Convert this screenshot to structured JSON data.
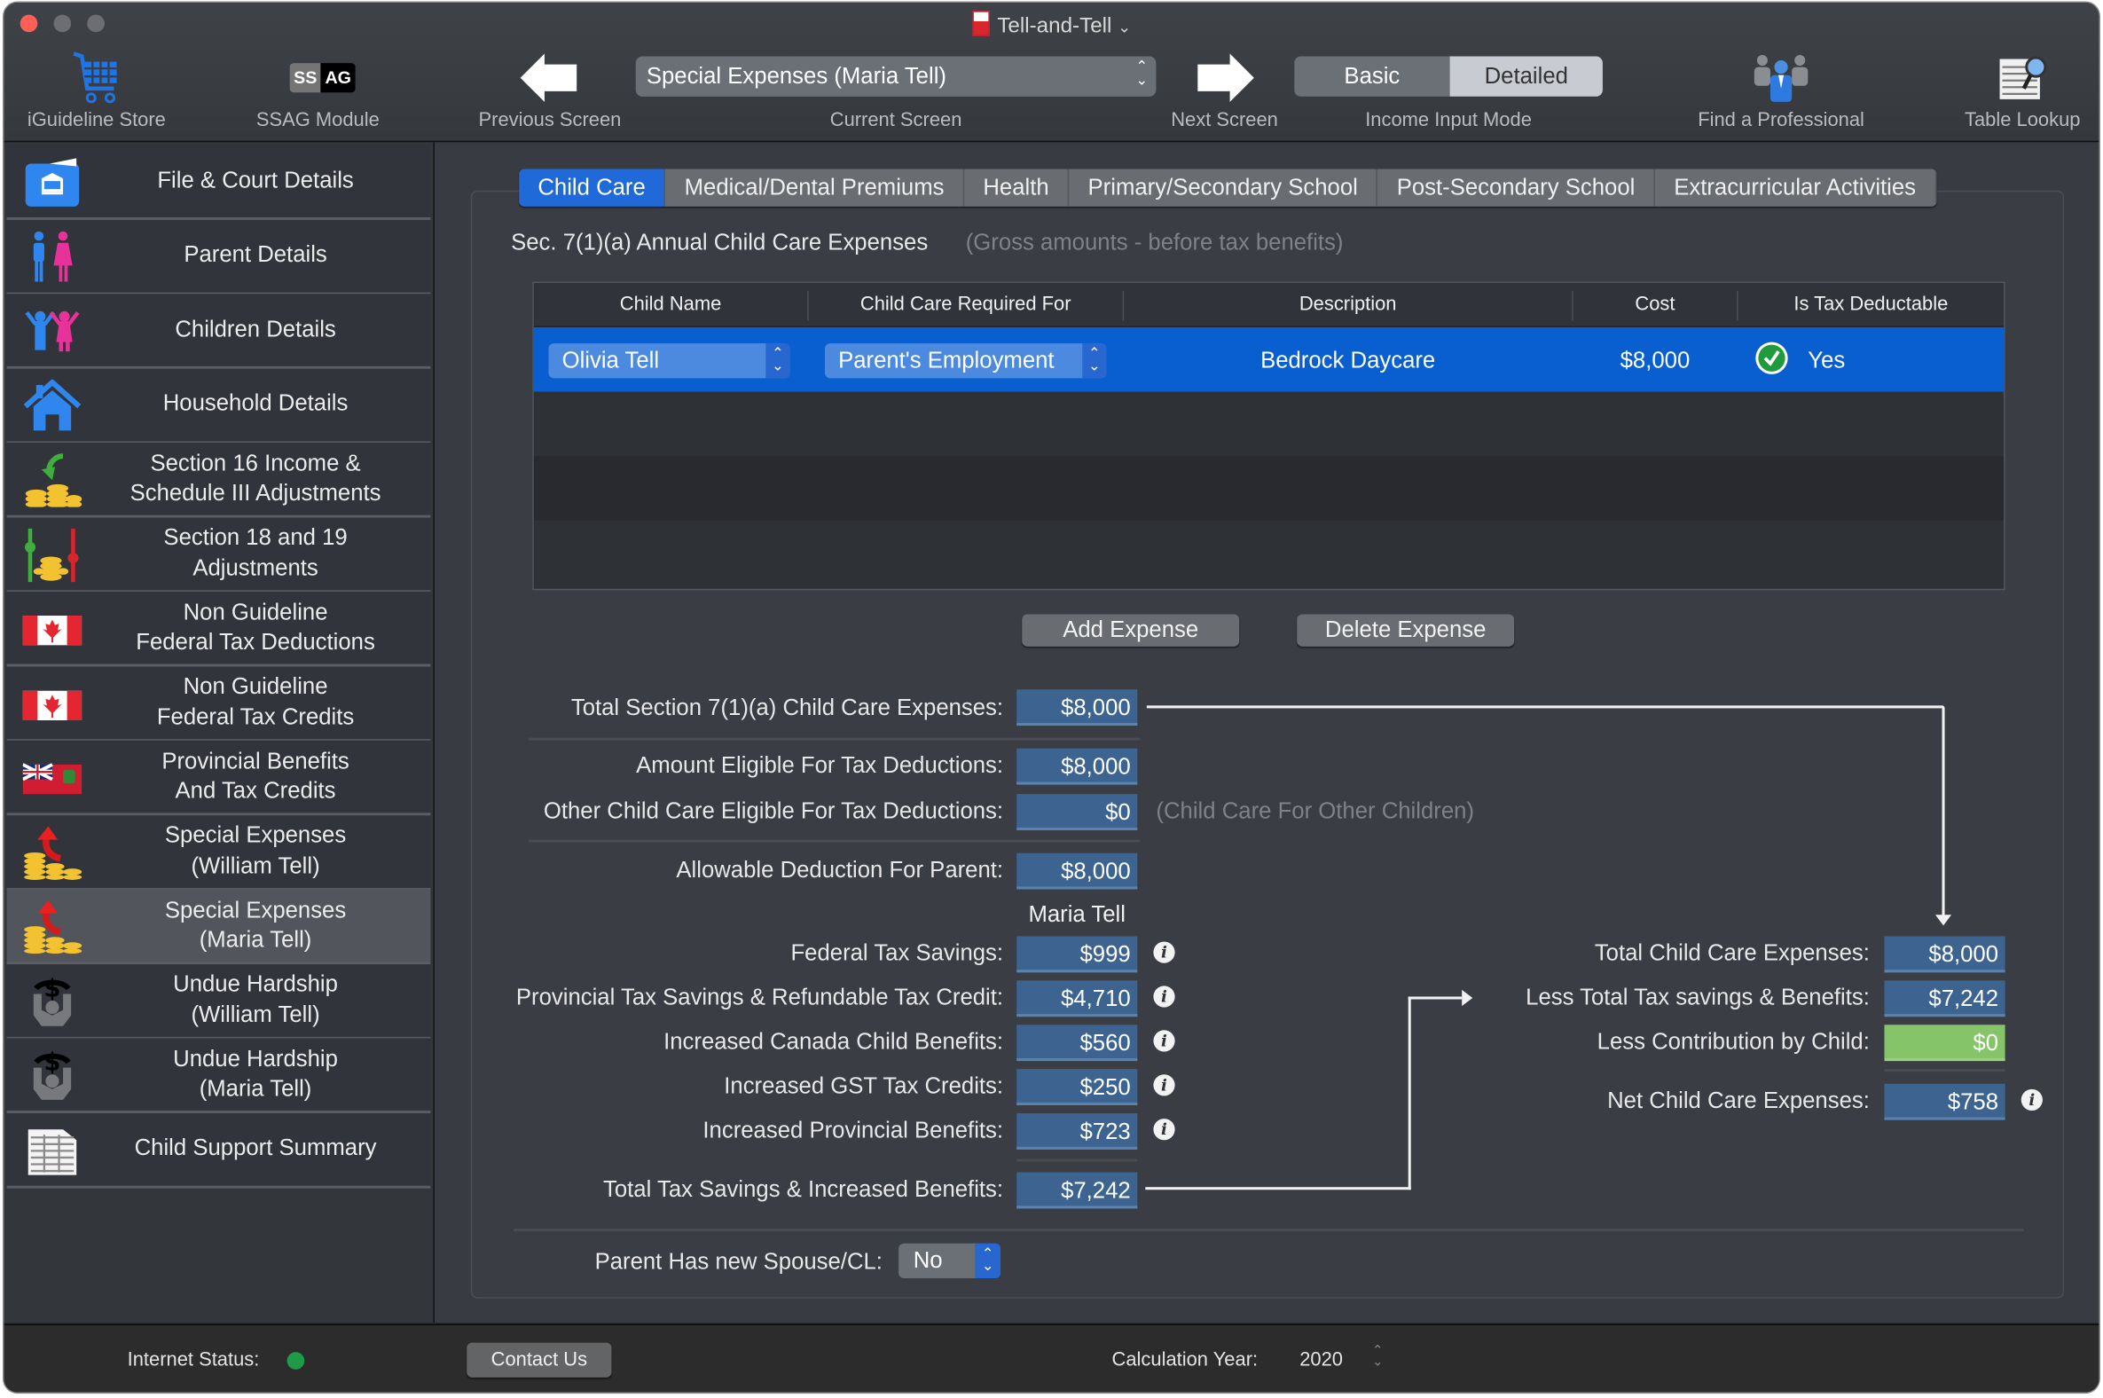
{
  "window": {
    "title": "Tell-and-Tell",
    "title_chevron": "⌄",
    "traffic_lights": {
      "close_color": "#ff5f57",
      "inactive_color": "#6c6e72"
    }
  },
  "toolbar": {
    "store_label": "iGuideline Store",
    "ssag_label": "SSAG Module",
    "ssag_badge_left": "SS",
    "ssag_badge_right": "AG",
    "prev_label": "Previous Screen",
    "current_screen_value": "Special Expenses (Maria Tell)",
    "current_screen_label": "Current Screen",
    "next_label": "Next Screen",
    "mode_basic": "Basic",
    "mode_detailed": "Detailed",
    "mode_selected": "Detailed",
    "mode_label": "Income Input Mode",
    "find_pro_label": "Find a Professional",
    "table_lookup_label": "Table Lookup"
  },
  "sidebar": {
    "selected_index": 10,
    "items": [
      {
        "label": "File & Court Details",
        "icon": "court-folder-icon"
      },
      {
        "label": "Parent Details",
        "icon": "parents-icon"
      },
      {
        "label": "Children Details",
        "icon": "children-icon"
      },
      {
        "label": "Household Details",
        "icon": "house-icon"
      },
      {
        "label": "Section 16 Income &\nSchedule III Adjustments",
        "icon": "income-coins-icon"
      },
      {
        "label": "Section 18 and 19\nAdjustments",
        "icon": "adjustment-coins-icon"
      },
      {
        "label": "Non Guideline\nFederal Tax Deductions",
        "icon": "canada-flag-icon"
      },
      {
        "label": "Non Guideline\nFederal Tax Credits",
        "icon": "canada-flag-icon"
      },
      {
        "label": "Provincial Benefits\nAnd Tax Credits",
        "icon": "ontario-flag-icon"
      },
      {
        "label": "Special Expenses\n(William Tell)",
        "icon": "special-expenses-icon"
      },
      {
        "label": "Special Expenses\n(Maria Tell)",
        "icon": "special-expenses-icon"
      },
      {
        "label": "Undue Hardship\n(William Tell)",
        "icon": "undue-hardship-icon"
      },
      {
        "label": "Undue Hardship\n(Maria Tell)",
        "icon": "undue-hardship-icon"
      },
      {
        "label": "Child Support Summary",
        "icon": "summary-sheet-icon"
      }
    ]
  },
  "tabs": [
    {
      "label": "Child Care",
      "active": true
    },
    {
      "label": "Medical/Dental Premiums",
      "active": false
    },
    {
      "label": "Health",
      "active": false
    },
    {
      "label": "Primary/Secondary School",
      "active": false
    },
    {
      "label": "Post-Secondary School",
      "active": false
    },
    {
      "label": "Extracurricular Activities",
      "active": false
    }
  ],
  "section": {
    "title": "Sec. 7(1)(a)  Annual Child Care Expenses",
    "hint": "(Gross amounts - before tax benefits)"
  },
  "table": {
    "columns": [
      "Child Name",
      "Child Care Required For",
      "Description",
      "Cost",
      "Is Tax Deductable"
    ],
    "rows": [
      {
        "child_name": "Olivia Tell",
        "required_for": "Parent's Employment",
        "description": "Bedrock Daycare",
        "cost": "$8,000",
        "tax_deductible": "Yes",
        "selected": true
      }
    ]
  },
  "buttons": {
    "add_expense": "Add Expense",
    "delete_expense": "Delete Expense"
  },
  "fields": {
    "total_section": {
      "label": "Total Section 7(1)(a) Child Care Expenses:",
      "value": "$8,000"
    },
    "amount_eligible": {
      "label": "Amount Eligible For Tax Deductions:",
      "value": "$8,000"
    },
    "other_eligible": {
      "label": "Other Child Care Eligible For Tax Deductions:",
      "value": "$0",
      "hint": "(Child Care For Other Children)"
    },
    "allowable": {
      "label": "Allowable Deduction For Parent:",
      "value": "$8,000"
    },
    "parent_name": "Maria Tell",
    "federal": {
      "label": "Federal Tax Savings:",
      "value": "$999"
    },
    "provincial": {
      "label": "Provincial Tax Savings & Refundable Tax Credit:",
      "value": "$4,710"
    },
    "ccb": {
      "label": "Increased Canada Child Benefits:",
      "value": "$560"
    },
    "gst": {
      "label": "Increased GST Tax Credits:",
      "value": "$250"
    },
    "prov_benefits": {
      "label": "Increased Provincial Benefits:",
      "value": "$723"
    },
    "total_savings": {
      "label": "Total Tax Savings & Increased Benefits:",
      "value": "$7,242"
    }
  },
  "summary": {
    "total_cc": {
      "label": "Total Child Care Expenses:",
      "value": "$8,000"
    },
    "less_savings": {
      "label": "Less Total Tax savings & Benefits:",
      "value": "$7,242"
    },
    "less_child": {
      "label": "Less Contribution by Child:",
      "value": "$0"
    },
    "net": {
      "label": "Net Child Care Expenses:",
      "value": "$758"
    }
  },
  "spouse": {
    "label": "Parent Has new Spouse/CL:",
    "value": "No"
  },
  "footer": {
    "internet_label": "Internet Status:",
    "internet_color": "#1e9a48",
    "contact": "Contact Us",
    "year_label": "Calculation Year:",
    "year_value": "2020"
  },
  "info_glyph": "i"
}
